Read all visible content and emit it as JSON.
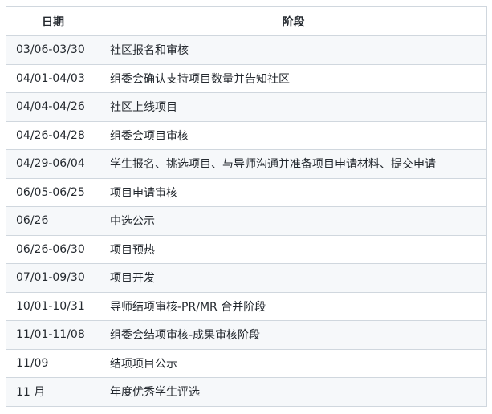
{
  "table": {
    "headers": {
      "date": "日期",
      "stage": "阶段"
    },
    "rows": [
      {
        "date": "03/06-03/30",
        "stage": "社区报名和审核"
      },
      {
        "date": "04/01-04/03",
        "stage": "组委会确认支持项目数量并告知社区"
      },
      {
        "date": "04/04-04/26",
        "stage": "社区上线项目"
      },
      {
        "date": "04/26-04/28",
        "stage": "组委会项目审核"
      },
      {
        "date": "04/29-06/04",
        "stage": "学生报名、挑选项目、与导师沟通并准备项目申请材料、提交申请"
      },
      {
        "date": "06/05-06/25",
        "stage": "项目申请审核"
      },
      {
        "date": "06/26",
        "stage": "中选公示"
      },
      {
        "date": "06/26-06/30",
        "stage": "项目预热"
      },
      {
        "date": "07/01-09/30",
        "stage": "项目开发"
      },
      {
        "date": "10/01-10/31",
        "stage": "导师结项审核-PR/MR 合并阶段"
      },
      {
        "date": "11/01-11/08",
        "stage": "组委会结项审核-成果审核阶段"
      },
      {
        "date": "11/09",
        "stage": "结项项目公示"
      },
      {
        "date": "11 月",
        "stage": "年度优秀学生评选"
      }
    ]
  }
}
